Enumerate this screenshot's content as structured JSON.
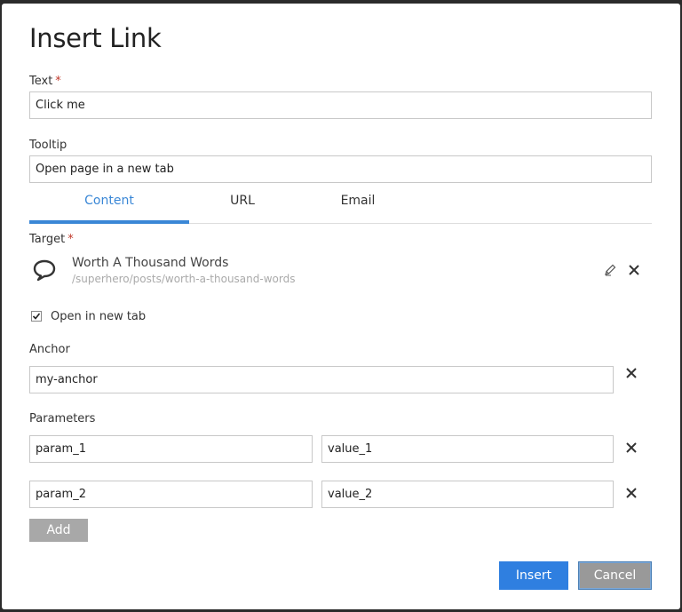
{
  "dialog": {
    "title": "Insert Link"
  },
  "text_field": {
    "label": "Text",
    "required_mark": "*",
    "value": "Click me"
  },
  "tooltip_field": {
    "label": "Tooltip",
    "value": "Open page in a new tab"
  },
  "tabs": [
    {
      "label": "Content",
      "active": true
    },
    {
      "label": "URL",
      "active": false
    },
    {
      "label": "Email",
      "active": false
    }
  ],
  "target": {
    "label": "Target",
    "required_mark": "*",
    "icon": "speech-bubble-icon",
    "title": "Worth A Thousand Words",
    "path": "/superhero/posts/worth-a-thousand-words"
  },
  "open_new_tab": {
    "label": "Open in new tab",
    "checked": true
  },
  "anchor": {
    "label": "Anchor",
    "value": "my-anchor"
  },
  "parameters": {
    "label": "Parameters",
    "rows": [
      {
        "name": "param_1",
        "value": "value_1"
      },
      {
        "name": "param_2",
        "value": "value_2"
      }
    ],
    "add_label": "Add"
  },
  "actions": {
    "insert_label": "Insert",
    "cancel_label": "Cancel"
  },
  "colors": {
    "accent": "#3a87d6",
    "insert_button": "#2f7fe0",
    "required": "#c0392b"
  }
}
